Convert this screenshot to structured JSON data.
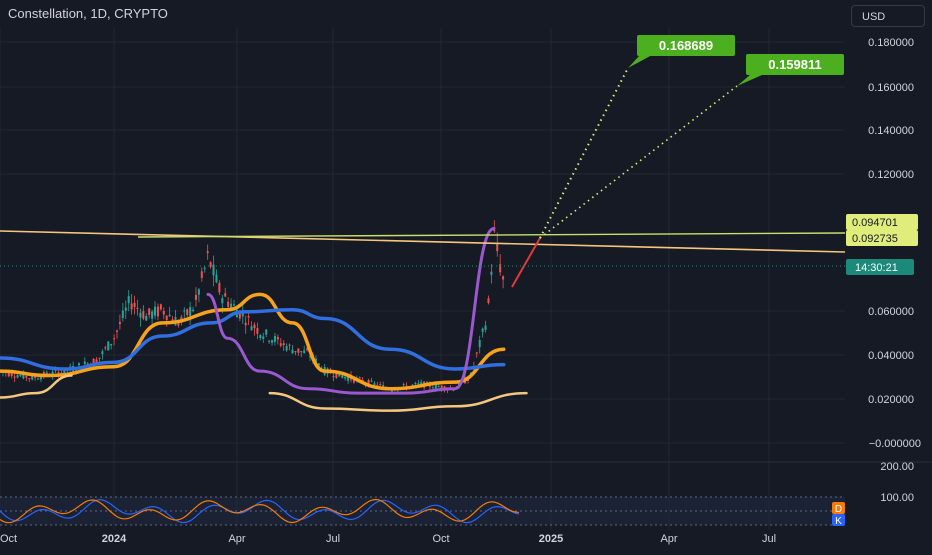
{
  "header": {
    "title": "Constellation, 1D, CRYPTO",
    "currency": "USD"
  },
  "colors": {
    "background": "#161a25",
    "grid": "#232734",
    "axis_text": "#d1d4dc",
    "up_candle": "#26a69a",
    "down_candle": "#ef5350",
    "price_label_yellow": "#e1ed7a",
    "target_green": "#4caf1f",
    "countdown_teal": "#1b8a7a"
  },
  "chart_data": {
    "type": "line",
    "title": "Constellation, 1D, CRYPTO",
    "ylim": [
      -0.01,
      0.19
    ],
    "grid": true,
    "y_ticks": [
      "0.180000",
      "0.160000",
      "0.140000",
      "0.120000",
      "0.060000",
      "0.040000",
      "0.020000",
      "−0.000000"
    ],
    "x_ticks": [
      "Oct",
      "2024",
      "Apr",
      "Jul",
      "Oct",
      "2025",
      "Apr",
      "Jul"
    ],
    "price_labels": [
      "0.094701",
      "0.092735"
    ],
    "countdown": "14:30:21",
    "targets": [
      "0.168689",
      "0.159811"
    ],
    "series": [
      {
        "name": "",
        "color": "#f7a21b",
        "x": [
          0,
          1.5,
          3.5,
          5,
          7,
          8,
          9,
          10,
          12,
          14,
          15.5
        ],
        "y": [
          0.03,
          0.028,
          0.032,
          0.052,
          0.058,
          0.065,
          0.052,
          0.03,
          0.022,
          0.025,
          0.04
        ]
      },
      {
        "name": "",
        "color": "#2f6fe0",
        "x": [
          0,
          2,
          3.5,
          5,
          6.5,
          7.5,
          9,
          10,
          12,
          14,
          15.5
        ],
        "y": [
          0.036,
          0.031,
          0.034,
          0.046,
          0.052,
          0.057,
          0.058,
          0.054,
          0.04,
          0.031,
          0.033
        ]
      },
      {
        "name": "",
        "color": "#9b59d0",
        "x": [
          6.4,
          7,
          8,
          9.5,
          11,
          12.5,
          14,
          15.2
        ],
        "y": [
          0.065,
          0.045,
          0.03,
          0.022,
          0.02,
          0.02,
          0.022,
          0.095
        ]
      },
      {
        "name": "",
        "color": "#f5c77e",
        "x": [
          0,
          1.1,
          2.2
        ],
        "y": [
          0.018,
          0.02,
          0.028
        ]
      },
      {
        "name": "",
        "color": "#f5c77e",
        "x": [
          8.3,
          10,
          12,
          14,
          16.2
        ],
        "y": [
          0.02,
          0.013,
          0.012,
          0.014,
          0.02
        ]
      }
    ]
  },
  "oscillator": {
    "top_label": "200.00",
    "mid_label": "100.00",
    "badge_d": "D",
    "badge_k": "K"
  }
}
